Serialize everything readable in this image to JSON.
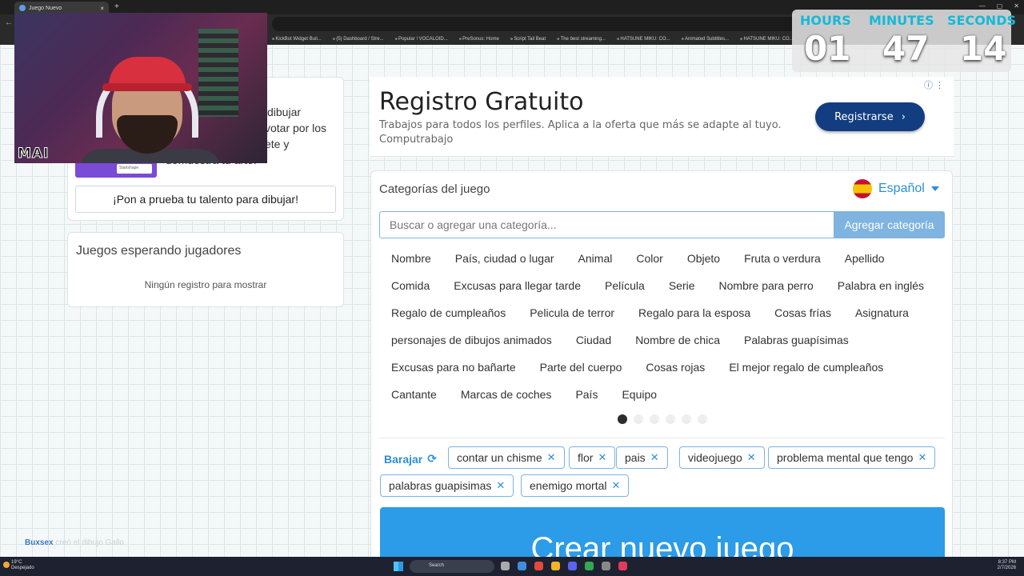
{
  "browser": {
    "tab_title": "Juego Nuevo",
    "bookmarks": [
      "KickBot Widget Buil...",
      "(5) Dashboard / Stre...",
      "Popular ! VOCALOID...",
      "PreSonus: Home",
      "Script Tail Beat",
      "The best streaming...",
      "HATSUNE MIKU: CO...",
      "Animated Subtitles...",
      "HATSUNE MIKU: CO..."
    ]
  },
  "webcam": {
    "overlay_text": "MAI"
  },
  "timer": {
    "hours_label": "HOURS",
    "hours": "01",
    "minutes_label": "MINUTES",
    "minutes": "47",
    "seconds_label": "SECONDS",
    "seconds": "14"
  },
  "left": {
    "promo_lines": [
      "dibujar",
      "votar por los",
      "ete y",
      "demuestra tu arte."
    ],
    "ad_chip": "Startshape",
    "draw_button": "¡Pon a prueba tu talento para dibujar!",
    "waiting_title": "Juegos esperando jugadores",
    "waiting_empty": "Ningún registro para mostrar",
    "footer_name": "Buxsex",
    "footer_rest": "creó el dibujo Gallo"
  },
  "ad": {
    "title": "Registro Gratuito",
    "description": "Trabajos para todos los perfiles. Aplica a la oferta que más se adapte al tuyo. Computrabajo",
    "button": "Registrarse",
    "info_icon": "ⓘ ⋮"
  },
  "categories": {
    "title": "Categorías del juego",
    "language": "Español",
    "search_placeholder": "Buscar o agregar una categoría...",
    "add_button": "Agregar categoría",
    "rows": [
      [
        "Nombre",
        "País, ciudad o lugar",
        "Animal",
        "Color",
        "Objeto",
        "Fruta o verdura",
        "Apellido"
      ],
      [
        "Comida",
        "Excusas para llegar tarde",
        "Película",
        "Serie",
        "Nombre para perro",
        "Palabra en inglés"
      ],
      [
        "Regalo de cumpleaños",
        "Pelicula de terror",
        "Regalo para la esposa",
        "Cosas frías",
        "Asignatura"
      ],
      [
        "personajes de dibujos animados",
        "Ciudad",
        "Nombre de chica",
        "Palabras guapísimas"
      ],
      [
        "Excusas para no bañarte",
        "Parte del cuerpo",
        "Cosas rojas",
        "El mejor regalo de cumpleaños"
      ],
      [
        "Cantante",
        "Marcas de coches",
        "País",
        "Equipo"
      ]
    ],
    "page_count": 6,
    "active_page": 1,
    "shuffle": "Barajar",
    "selected": [
      "contar un chisme",
      "flor",
      "pais",
      "videojuego",
      "problema mental que tengo",
      "palabras guapisimas",
      "enemigo mortal"
    ],
    "create_button": "Crear nuevo juego"
  },
  "taskbar": {
    "temp": "19°C",
    "weather": "Despejado",
    "search": "Search",
    "time": "8:37 PM",
    "date": "2/7/2026"
  },
  "colors": {
    "accent": "#2d8fd6",
    "create_button": "#2c9be8",
    "ad_button": "#123d80",
    "timer_label": "#16b9d8"
  }
}
